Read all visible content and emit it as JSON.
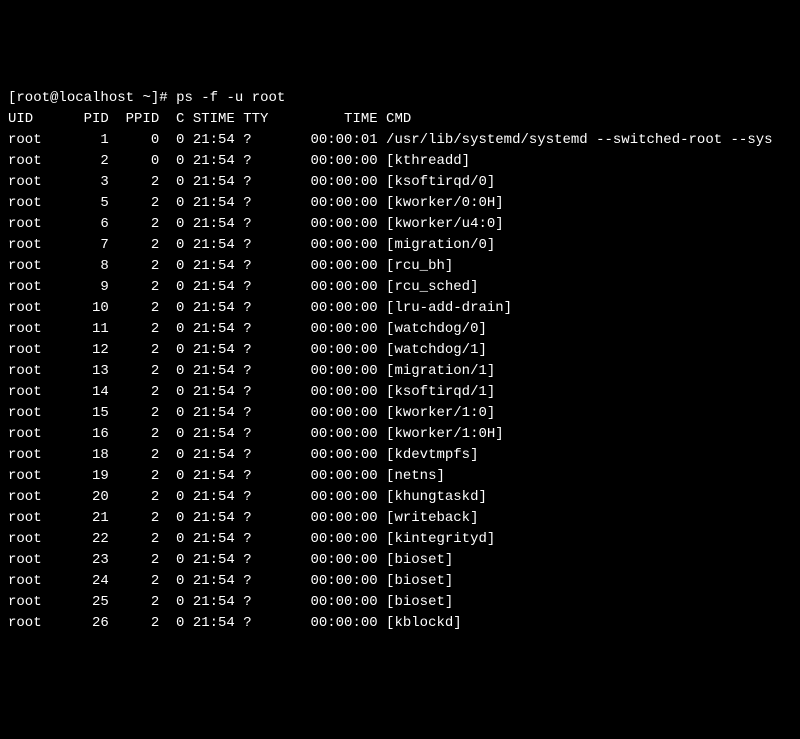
{
  "prompt": {
    "user": "root",
    "host": "localhost",
    "dir": "~",
    "symbol": "#",
    "command": "ps -f -u root"
  },
  "headers": {
    "uid": "UID",
    "pid": "PID",
    "ppid": "PPID",
    "c": "C",
    "stime": "STIME",
    "tty": "TTY",
    "time": "TIME",
    "cmd": "CMD"
  },
  "processes": [
    {
      "uid": "root",
      "pid": "1",
      "ppid": "0",
      "c": "0",
      "stime": "21:54",
      "tty": "?",
      "time": "00:00:01",
      "cmd": "/usr/lib/systemd/systemd --switched-root --sys"
    },
    {
      "uid": "root",
      "pid": "2",
      "ppid": "0",
      "c": "0",
      "stime": "21:54",
      "tty": "?",
      "time": "00:00:00",
      "cmd": "[kthreadd]"
    },
    {
      "uid": "root",
      "pid": "3",
      "ppid": "2",
      "c": "0",
      "stime": "21:54",
      "tty": "?",
      "time": "00:00:00",
      "cmd": "[ksoftirqd/0]"
    },
    {
      "uid": "root",
      "pid": "5",
      "ppid": "2",
      "c": "0",
      "stime": "21:54",
      "tty": "?",
      "time": "00:00:00",
      "cmd": "[kworker/0:0H]"
    },
    {
      "uid": "root",
      "pid": "6",
      "ppid": "2",
      "c": "0",
      "stime": "21:54",
      "tty": "?",
      "time": "00:00:00",
      "cmd": "[kworker/u4:0]"
    },
    {
      "uid": "root",
      "pid": "7",
      "ppid": "2",
      "c": "0",
      "stime": "21:54",
      "tty": "?",
      "time": "00:00:00",
      "cmd": "[migration/0]"
    },
    {
      "uid": "root",
      "pid": "8",
      "ppid": "2",
      "c": "0",
      "stime": "21:54",
      "tty": "?",
      "time": "00:00:00",
      "cmd": "[rcu_bh]"
    },
    {
      "uid": "root",
      "pid": "9",
      "ppid": "2",
      "c": "0",
      "stime": "21:54",
      "tty": "?",
      "time": "00:00:00",
      "cmd": "[rcu_sched]"
    },
    {
      "uid": "root",
      "pid": "10",
      "ppid": "2",
      "c": "0",
      "stime": "21:54",
      "tty": "?",
      "time": "00:00:00",
      "cmd": "[lru-add-drain]"
    },
    {
      "uid": "root",
      "pid": "11",
      "ppid": "2",
      "c": "0",
      "stime": "21:54",
      "tty": "?",
      "time": "00:00:00",
      "cmd": "[watchdog/0]"
    },
    {
      "uid": "root",
      "pid": "12",
      "ppid": "2",
      "c": "0",
      "stime": "21:54",
      "tty": "?",
      "time": "00:00:00",
      "cmd": "[watchdog/1]"
    },
    {
      "uid": "root",
      "pid": "13",
      "ppid": "2",
      "c": "0",
      "stime": "21:54",
      "tty": "?",
      "time": "00:00:00",
      "cmd": "[migration/1]"
    },
    {
      "uid": "root",
      "pid": "14",
      "ppid": "2",
      "c": "0",
      "stime": "21:54",
      "tty": "?",
      "time": "00:00:00",
      "cmd": "[ksoftirqd/1]"
    },
    {
      "uid": "root",
      "pid": "15",
      "ppid": "2",
      "c": "0",
      "stime": "21:54",
      "tty": "?",
      "time": "00:00:00",
      "cmd": "[kworker/1:0]"
    },
    {
      "uid": "root",
      "pid": "16",
      "ppid": "2",
      "c": "0",
      "stime": "21:54",
      "tty": "?",
      "time": "00:00:00",
      "cmd": "[kworker/1:0H]"
    },
    {
      "uid": "root",
      "pid": "18",
      "ppid": "2",
      "c": "0",
      "stime": "21:54",
      "tty": "?",
      "time": "00:00:00",
      "cmd": "[kdevtmpfs]"
    },
    {
      "uid": "root",
      "pid": "19",
      "ppid": "2",
      "c": "0",
      "stime": "21:54",
      "tty": "?",
      "time": "00:00:00",
      "cmd": "[netns]"
    },
    {
      "uid": "root",
      "pid": "20",
      "ppid": "2",
      "c": "0",
      "stime": "21:54",
      "tty": "?",
      "time": "00:00:00",
      "cmd": "[khungtaskd]"
    },
    {
      "uid": "root",
      "pid": "21",
      "ppid": "2",
      "c": "0",
      "stime": "21:54",
      "tty": "?",
      "time": "00:00:00",
      "cmd": "[writeback]"
    },
    {
      "uid": "root",
      "pid": "22",
      "ppid": "2",
      "c": "0",
      "stime": "21:54",
      "tty": "?",
      "time": "00:00:00",
      "cmd": "[kintegrityd]"
    },
    {
      "uid": "root",
      "pid": "23",
      "ppid": "2",
      "c": "0",
      "stime": "21:54",
      "tty": "?",
      "time": "00:00:00",
      "cmd": "[bioset]"
    },
    {
      "uid": "root",
      "pid": "24",
      "ppid": "2",
      "c": "0",
      "stime": "21:54",
      "tty": "?",
      "time": "00:00:00",
      "cmd": "[bioset]"
    },
    {
      "uid": "root",
      "pid": "25",
      "ppid": "2",
      "c": "0",
      "stime": "21:54",
      "tty": "?",
      "time": "00:00:00",
      "cmd": "[bioset]"
    },
    {
      "uid": "root",
      "pid": "26",
      "ppid": "2",
      "c": "0",
      "stime": "21:54",
      "tty": "?",
      "time": "00:00:00",
      "cmd": "[kblockd]"
    }
  ]
}
